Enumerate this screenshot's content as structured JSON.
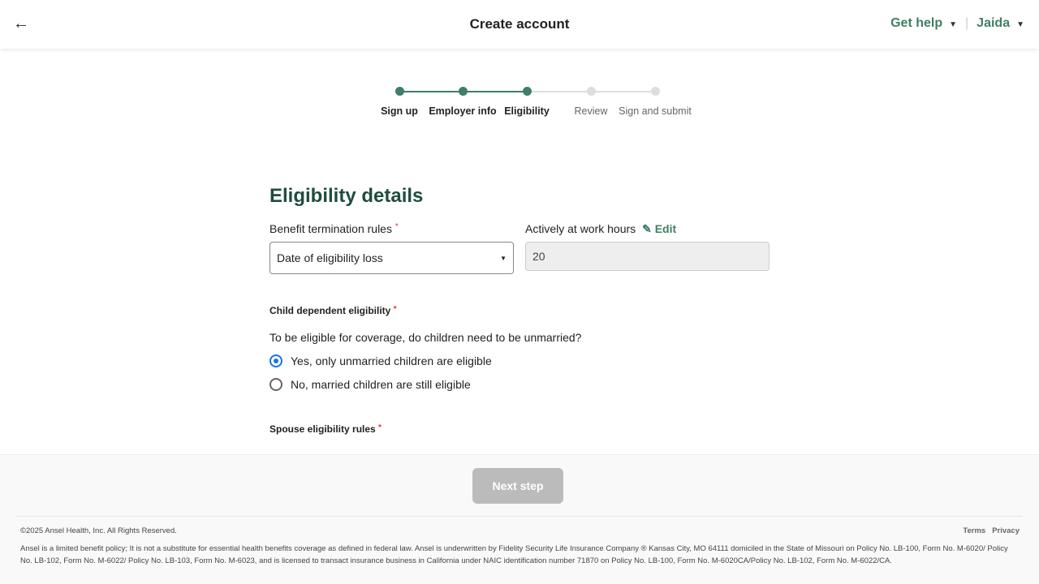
{
  "header": {
    "title": "Create account",
    "help": "Get help",
    "user": "Jaida"
  },
  "steps": [
    {
      "label": "Sign up",
      "done": true
    },
    {
      "label": "Employer info",
      "done": true
    },
    {
      "label": "Eligibility",
      "done": true
    },
    {
      "label": "Review",
      "done": false
    },
    {
      "label": "Sign and submit",
      "done": false
    }
  ],
  "colors": {
    "accent": "#3f7f65",
    "inactive": "#dddddd"
  },
  "form": {
    "heading": "Eligibility details",
    "termination_label": "Benefit termination rules",
    "termination_value": "Date of eligibility loss",
    "hours_label": "Actively at work hours",
    "edit": "Edit",
    "hours_value": "20",
    "child_label": "Child dependent eligibility",
    "child_question": "To be eligible for coverage, do children need to be unmarried?",
    "options": [
      {
        "label": "Yes, only unmarried children are eligible",
        "selected": true
      },
      {
        "label": "No, married children are still eligible",
        "selected": false
      }
    ],
    "spouse_label": "Spouse eligibility rules",
    "required": "*"
  },
  "footer": {
    "next": "Next step",
    "copyright": "©2025 Ansel Health, Inc. All Rights Reserved.",
    "terms": "Terms",
    "privacy": "Privacy",
    "legal": "Ansel is a limited benefit policy; It is not a substitute for essential health benefits coverage as defined in federal law. Ansel is underwritten by Fidelity Security Life Insurance Company ® Kansas City, MO 64111 domiciled in the State of Missouri on Policy No. LB-100, Form No. M-6020/ Policy No. LB-102, Form No. M-6022/ Policy No. LB-103, Form No. M-6023, and is licensed to transact insurance business in California under NAIC identification number 71870 on Policy No. LB-100, Form No. M-6020CA/Policy No. LB-102, Form No. M-6022/CA."
  }
}
